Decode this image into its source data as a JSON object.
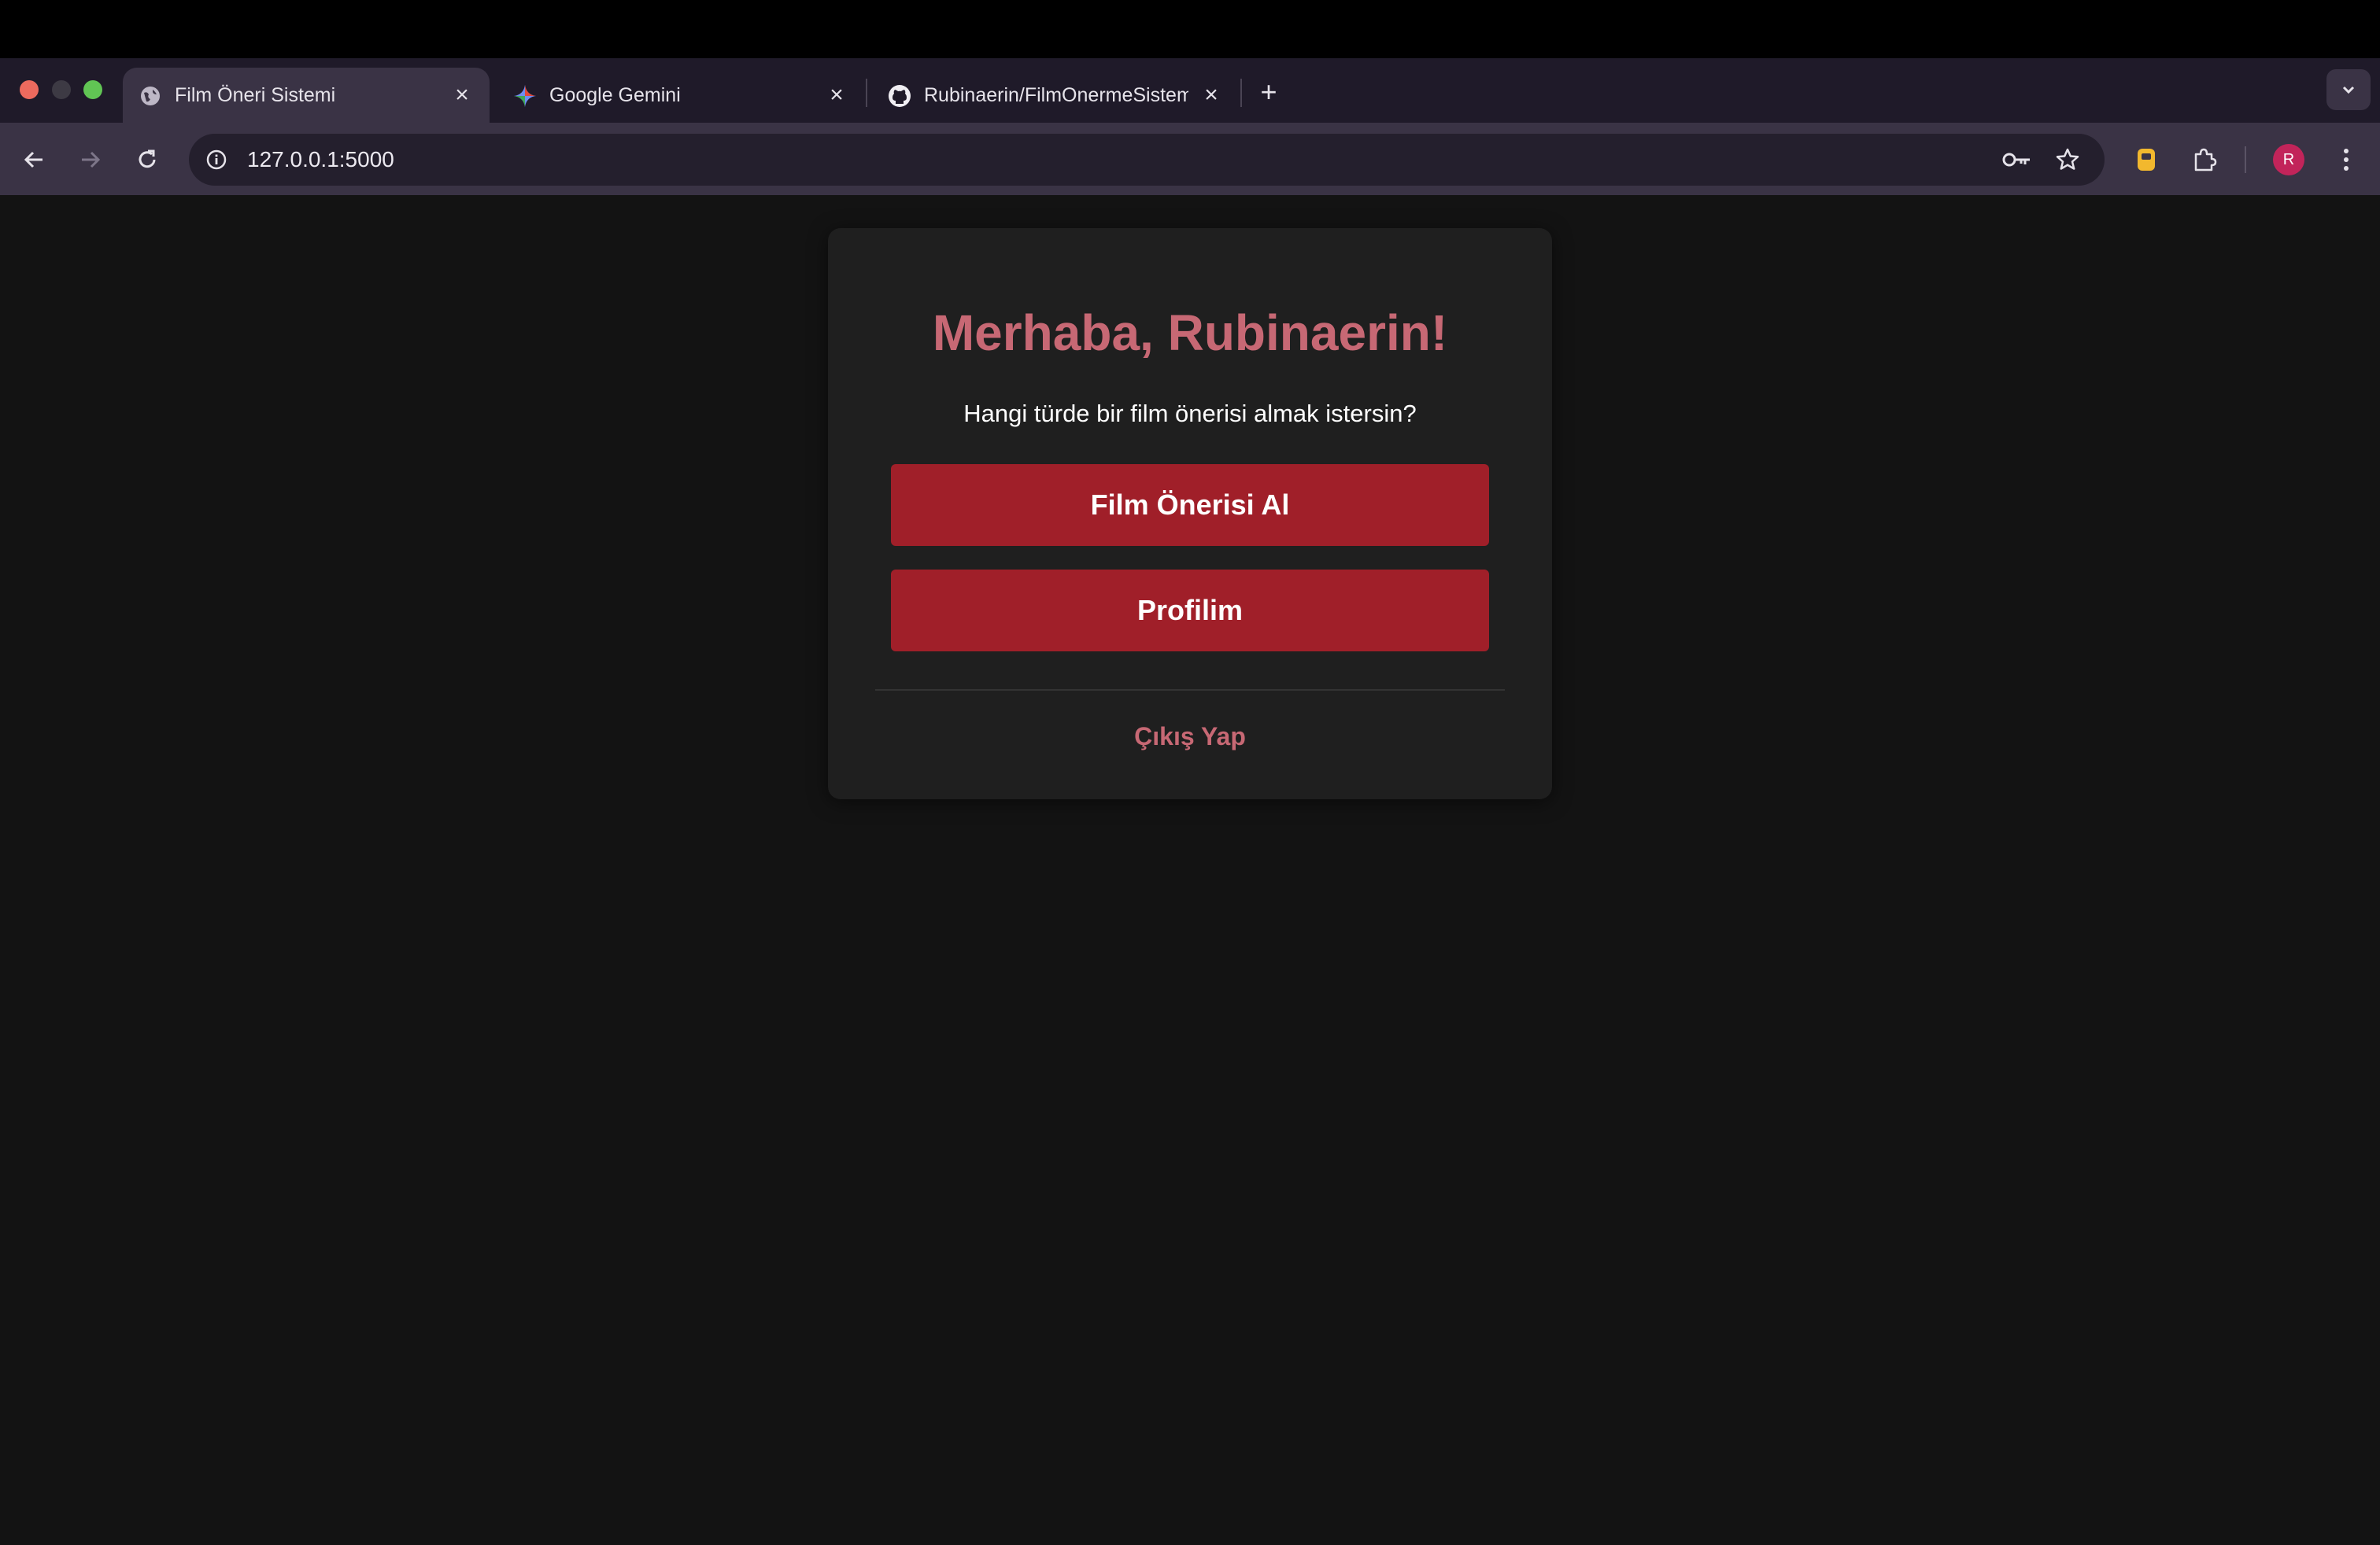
{
  "browser": {
    "tabs": [
      {
        "title": "Film Öneri Sistemi",
        "active": true,
        "icon": "globe-icon"
      },
      {
        "title": "Google Gemini",
        "active": false,
        "icon": "gemini-icon"
      },
      {
        "title": "Rubinaerin/FilmOnermeSistem",
        "active": false,
        "icon": "github-icon"
      }
    ],
    "address": "127.0.0.1:5000",
    "profile_initial": "R",
    "colors": {
      "frame": "#1f1a29",
      "toolbar": "#3a3345",
      "avatar": "#c2245a"
    }
  },
  "page": {
    "greeting": "Merhaba, Rubinaerin!",
    "subtitle": "Hangi türde bir film önerisi almak istersin?",
    "buttons": {
      "recommend": "Film Önerisi Al",
      "profile": "Profilim"
    },
    "logout": "Çıkış Yap",
    "colors": {
      "background": "#131313",
      "card": "#1f1f1f",
      "accent": "#c76874",
      "button": "#a01f29"
    }
  }
}
